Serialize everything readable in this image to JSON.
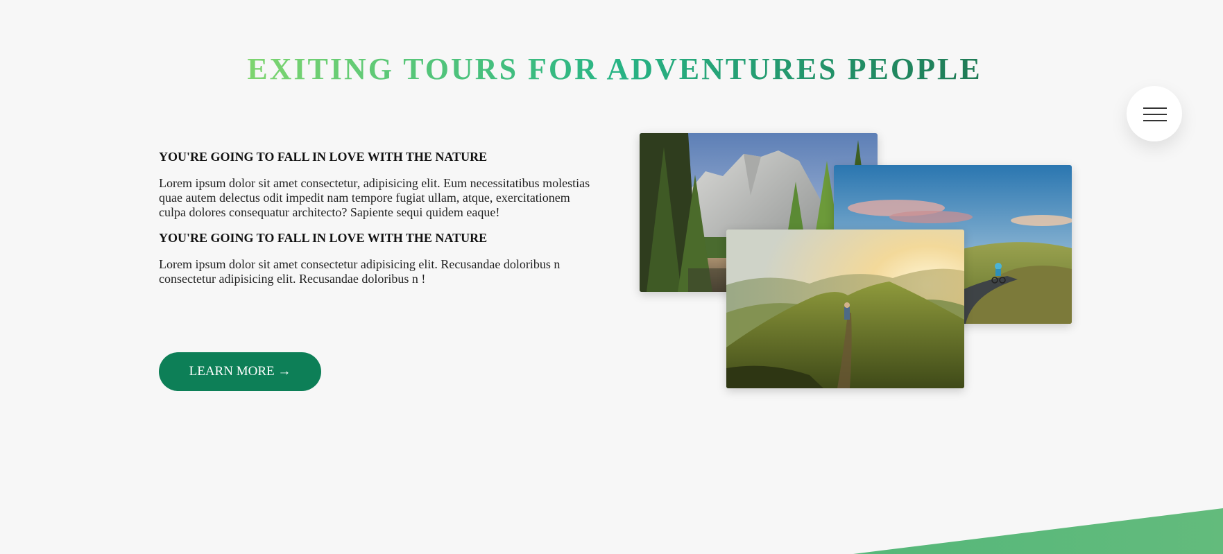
{
  "header": {
    "title": "EXITING TOURS FOR ADVENTURES PEOPLE"
  },
  "about": {
    "sections": [
      {
        "heading": "YOU'RE GOING TO FALL IN LOVE WITH THE NATURE",
        "body": "Lorem ipsum dolor sit amet consectetur, adipisicing elit. Eum necessitatibus molestias quae autem delectus odit impedit nam tempore fugiat ullam, atque, exercitationem culpa dolores consequatur architecto? Sapiente sequi quidem eaque!"
      },
      {
        "heading": "YOU'RE GOING TO FALL IN LOVE WITH THE NATURE",
        "body": "Lorem ipsum dolor sit amet consectetur adipisicing elit. Recusandae doloribus n consectetur adipisicing elit. Recusandae doloribus n !"
      }
    ],
    "cta_label": "LEARN MORE →"
  },
  "photos": [
    {
      "subject": "forest-cliff-photo"
    },
    {
      "subject": "cyclist-road-photo"
    },
    {
      "subject": "mountain-ridge-hiker-photo"
    }
  ],
  "navigation": {
    "icon": "hamburger-menu-icon"
  },
  "colors": {
    "accent_green": "#0d7f57",
    "gradient_start": "#7ed56f",
    "gradient_end": "#1f7a55",
    "background": "#f7f7f7"
  }
}
